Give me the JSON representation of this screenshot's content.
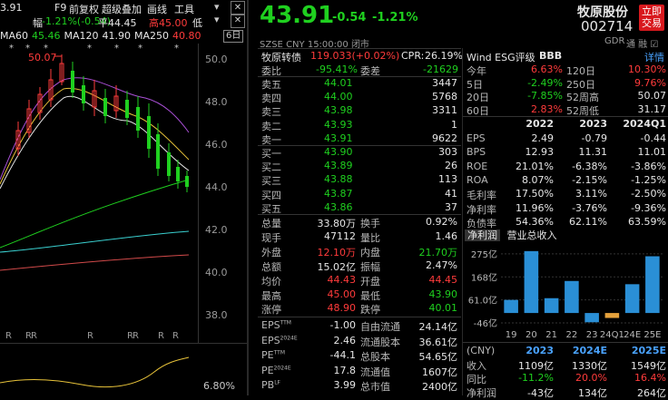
{
  "chart": {
    "top_items": [
      "3.91",
      "幅",
      "-1.21%(-0.54)",
      "超级叠加",
      "画线",
      "工具"
    ],
    "f9": "F9",
    "fq": "前复权",
    "price_line": "平44.45",
    "high_line": "高45.00",
    "low_line": "低",
    "ma_labels": [
      {
        "text": "MA60",
        "color": "#e6e6e6"
      },
      {
        "text": "45.46",
        "color": "#1fd01f"
      },
      {
        "text": "MA120",
        "color": "#e6e6e6"
      },
      {
        "text": "41.90",
        "color": "#e6e6e6"
      },
      {
        "text": "MA250",
        "color": "#e6e6e6"
      },
      {
        "text": "40.80",
        "color": "#ff3b3b"
      }
    ],
    "period": "6日",
    "peak_label": "50.07",
    "y_ticks": [
      "50.0",
      "48.0",
      "46.0",
      "44.0",
      "42.0",
      "40.0",
      "38.0"
    ],
    "r_marks": [
      "R",
      "R",
      "R",
      "R",
      "R",
      "R",
      "R",
      "R"
    ],
    "bottom_pct": "6.80%"
  },
  "quote": {
    "price": "43.91",
    "change": "-0.54",
    "change_pct": "-1.21%",
    "name": "牧原股份",
    "code": "002714",
    "buy_btn_line1": "立即",
    "buy_btn_line2": "交易",
    "exchange": "SZSE",
    "currency": "CNY",
    "time": "15:00:00",
    "status": "闭市",
    "gdr": "GDR",
    "flags": "通 融 ☑"
  },
  "cb": {
    "label": "牧原转债",
    "value": "119.033(+0.02%)",
    "cpr_label": "CPR:",
    "cpr_value": "26.19%"
  },
  "weibi": {
    "label": "委比",
    "value": "-95.41%",
    "label2": "委差",
    "value2": "-21629"
  },
  "sell": [
    {
      "label": "卖五",
      "price": "44.01",
      "vol": "3447"
    },
    {
      "label": "卖四",
      "price": "44.00",
      "vol": "5768"
    },
    {
      "label": "卖三",
      "price": "43.98",
      "vol": "3311"
    },
    {
      "label": "卖二",
      "price": "43.93",
      "vol": "1"
    },
    {
      "label": "卖一",
      "price": "43.91",
      "vol": "9622"
    }
  ],
  "buy": [
    {
      "label": "买一",
      "price": "43.90",
      "vol": "303"
    },
    {
      "label": "买二",
      "price": "43.89",
      "vol": "26"
    },
    {
      "label": "买三",
      "price": "43.88",
      "vol": "113"
    },
    {
      "label": "买四",
      "price": "43.87",
      "vol": "41"
    },
    {
      "label": "买五",
      "price": "43.86",
      "vol": "37"
    }
  ],
  "stats": [
    {
      "l1": "总量",
      "v1": "33.80万",
      "c1": "white",
      "l2": "换手",
      "v2": "0.92%",
      "c2": "white"
    },
    {
      "l1": "现手",
      "v1": "47112",
      "c1": "white",
      "l2": "量比",
      "v2": "1.46",
      "c2": "white"
    },
    {
      "l1": "外盘",
      "v1": "12.10万",
      "c1": "red",
      "l2": "内盘",
      "v2": "21.70万",
      "c2": "green"
    },
    {
      "l1": "总额",
      "v1": "15.02亿",
      "c1": "white",
      "l2": "振幅",
      "v2": "2.47%",
      "c2": "white"
    },
    {
      "l1": "均价",
      "v1": "44.43",
      "c1": "red",
      "l2": "开盘",
      "v2": "44.45",
      "c2": "red"
    },
    {
      "l1": "最高",
      "v1": "45.00",
      "c1": "red",
      "l2": "最低",
      "v2": "43.90",
      "c2": "green"
    },
    {
      "l1": "涨停",
      "v1": "48.90",
      "c1": "red",
      "l2": "跌停",
      "v2": "40.01",
      "c2": "green"
    }
  ],
  "valuation": [
    {
      "l1": "EPS",
      "s1": "TTM",
      "v1": "-1.00",
      "l2": "自由流通",
      "v2": "24.14亿"
    },
    {
      "l1": "EPS",
      "s1": "2024E",
      "v1": "2.46",
      "l2": "流通股本",
      "v2": "36.61亿"
    },
    {
      "l1": "PE",
      "s1": "TTM",
      "v1": "-44.1",
      "l2": "总股本",
      "v2": "54.65亿"
    },
    {
      "l1": "PE",
      "s1": "2024E",
      "v1": "17.8",
      "l2": "流通值",
      "v2": "1607亿"
    },
    {
      "l1": "PB",
      "s1": "LF",
      "v1": "3.99",
      "l2": "总市值",
      "v2": "2400亿"
    }
  ],
  "esg": {
    "label": "Wind ESG评级",
    "value": "BBB",
    "detail": "详情"
  },
  "perf": [
    {
      "l1": "今年",
      "v1": "6.63%",
      "c1": "red",
      "l2": "120日",
      "v2": "10.30%",
      "c2": "red"
    },
    {
      "l1": "5日",
      "v1": "-2.49%",
      "c1": "green",
      "l2": "250日",
      "v2": "9.76%",
      "c2": "red"
    },
    {
      "l1": "20日",
      "v1": "-7.85%",
      "c1": "green",
      "l2": "52周高",
      "v2": "50.07",
      "c2": "white"
    },
    {
      "l1": "60日",
      "v1": "2.83%",
      "c1": "red",
      "l2": "52周低",
      "v2": "31.17",
      "c2": "white"
    }
  ],
  "fin": {
    "headers": [
      "2022",
      "2023",
      "2024Q1"
    ],
    "rows": [
      {
        "label": "EPS",
        "vals": [
          "2.49",
          "-0.79",
          "-0.44"
        ]
      },
      {
        "label": "BPS",
        "vals": [
          "12.93",
          "11.31",
          "11.01"
        ]
      },
      {
        "label": "ROE",
        "vals": [
          "21.01%",
          "-6.38%",
          "-3.86%"
        ]
      },
      {
        "label": "ROA",
        "vals": [
          "8.07%",
          "-2.15%",
          "-1.25%"
        ]
      },
      {
        "label": "毛利率",
        "vals": [
          "17.50%",
          "3.11%",
          "-2.50%"
        ]
      },
      {
        "label": "净利率",
        "vals": [
          "11.96%",
          "-3.76%",
          "-9.36%"
        ]
      },
      {
        "label": "负债率",
        "vals": [
          "54.36%",
          "62.11%",
          "63.59%"
        ]
      }
    ]
  },
  "tabs": {
    "t1": "净利润",
    "t2": "营业总收入"
  },
  "chart_data": {
    "type": "bar",
    "title": "",
    "categories": [
      "19",
      "20",
      "21",
      "22",
      "23",
      "24Q1",
      "24E",
      "25E"
    ],
    "values": [
      61,
      288,
      69,
      149,
      -43,
      -23,
      134,
      264
    ],
    "colors": [
      "#2a8fd6",
      "#2a8fd6",
      "#2a8fd6",
      "#2a8fd6",
      "#2a8fd6",
      "#e6a23c",
      "#2a8fd6",
      "#2a8fd6"
    ],
    "y_ticks": [
      "275亿",
      "168亿",
      "61.0亿",
      "-46亿"
    ],
    "ylim": [
      -46,
      300
    ]
  },
  "forecast": {
    "unit": "(CNY)",
    "headers": [
      "2023",
      "2024E",
      "2025E"
    ],
    "rows": [
      {
        "label": "收入",
        "vals": [
          "1109亿",
          "1330亿",
          "1549亿"
        ],
        "colors": [
          "white",
          "white",
          "white"
        ]
      },
      {
        "label": "同比",
        "vals": [
          "-11.2%",
          "20.0%",
          "16.4%"
        ],
        "colors": [
          "green",
          "red",
          "red"
        ]
      },
      {
        "label": "净利润",
        "vals": [
          "-43亿",
          "134亿",
          "264亿"
        ],
        "colors": [
          "white",
          "white",
          "white"
        ]
      }
    ]
  }
}
